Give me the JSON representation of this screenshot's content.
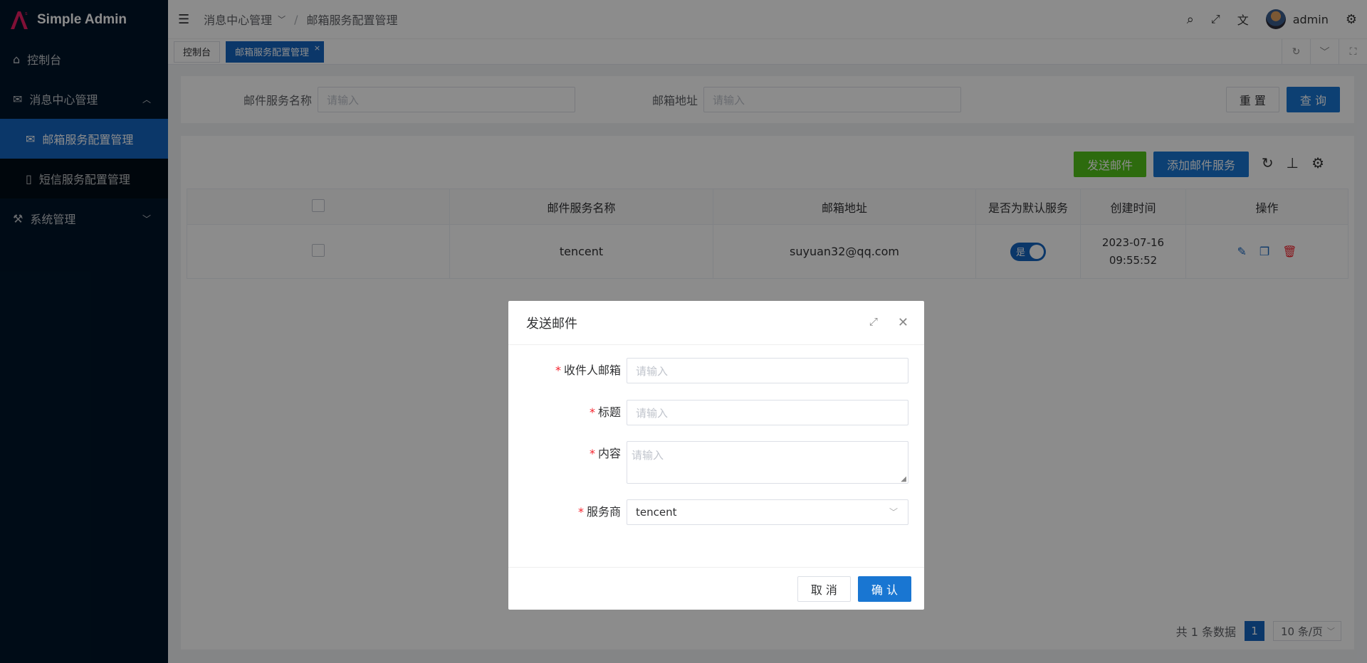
{
  "app": {
    "title": "Simple Admin"
  },
  "sidebar": {
    "items": [
      {
        "label": "控制台"
      },
      {
        "label": "消息中心管理"
      },
      {
        "label": "邮箱服务配置管理"
      },
      {
        "label": "短信服务配置管理"
      },
      {
        "label": "系统管理"
      }
    ]
  },
  "header": {
    "breadcrumb": [
      "消息中心管理",
      "/",
      "邮箱服务配置管理"
    ],
    "user": "admin"
  },
  "tabs": [
    {
      "label": "控制台"
    },
    {
      "label": "邮箱服务配置管理"
    }
  ],
  "search": {
    "name_label": "邮件服务名称",
    "name_placeholder": "请输入",
    "addr_label": "邮箱地址",
    "addr_placeholder": "请输入",
    "reset": "重 置",
    "query": "查 询"
  },
  "toolbar": {
    "send": "发送邮件",
    "add": "添加邮件服务"
  },
  "table": {
    "headers": [
      "邮件服务名称",
      "邮箱地址",
      "是否为默认服务",
      "创建时间",
      "操作"
    ],
    "rows": [
      {
        "name": "tencent",
        "email": "suyuan32@qq.com",
        "default": "是",
        "date": "2023-07-16",
        "time": "09:55:52"
      }
    ]
  },
  "pager": {
    "total": "共 1 条数据",
    "page": "1",
    "size": "10 条/页"
  },
  "modal": {
    "title": "发送邮件",
    "fields": [
      {
        "label": "收件人邮箱",
        "value": "请输入"
      },
      {
        "label": "标题",
        "value": "请输入"
      },
      {
        "label": "内容",
        "value": "请输入"
      },
      {
        "label": "服务商",
        "value": "tencent"
      }
    ],
    "cancel": "取 消",
    "ok": "确 认"
  },
  "colors": {
    "primary": "#1565c0",
    "success": "#52c41a",
    "sidebar": "#001529",
    "danger": "#f5222d"
  }
}
